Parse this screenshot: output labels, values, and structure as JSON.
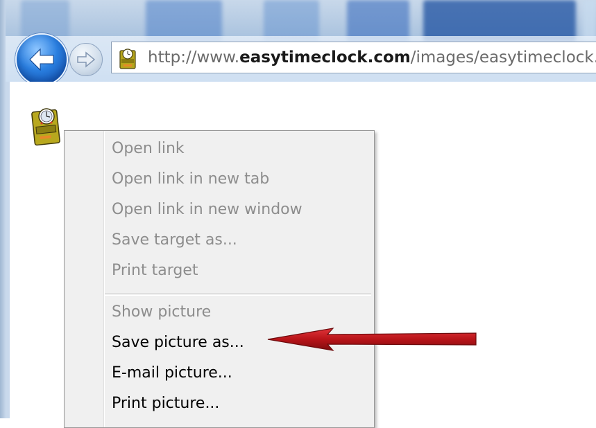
{
  "browser": {
    "url_prefix": "http://www.",
    "url_domain": "easytimeclock.com",
    "url_path": "/images/easytimeclock.ico",
    "back_icon": "back-arrow-icon",
    "forward_icon": "forward-arrow-icon",
    "favicon": "time-clock-icon"
  },
  "context_menu": {
    "items": [
      {
        "label": "Open link",
        "enabled": false
      },
      {
        "label": "Open link in new tab",
        "enabled": false
      },
      {
        "label": "Open link in new window",
        "enabled": false
      },
      {
        "label": "Save target as...",
        "enabled": false
      },
      {
        "label": "Print target",
        "enabled": false
      },
      {
        "label": "Show picture",
        "enabled": false
      },
      {
        "label": "Save picture as...",
        "enabled": true
      },
      {
        "label": "E-mail picture...",
        "enabled": true
      },
      {
        "label": "Print picture...",
        "enabled": true
      }
    ]
  },
  "annotation": {
    "arrow_color": "#c0161b",
    "points_to": "Save picture as..."
  }
}
